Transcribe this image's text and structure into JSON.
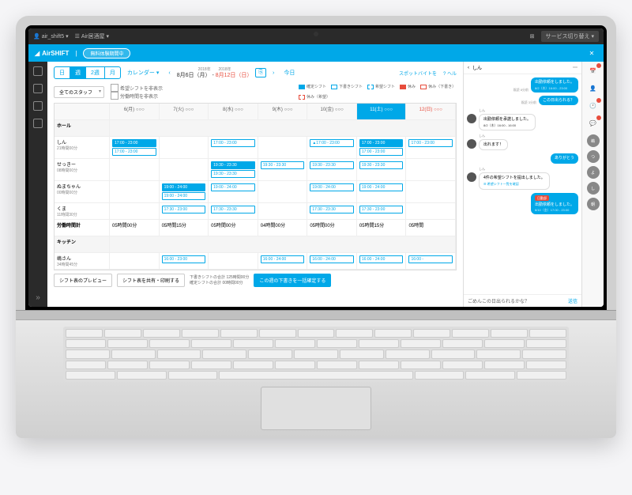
{
  "titlebar": {
    "user": "air_shift5",
    "store": "Air居酒屋",
    "service": "サービス切り替え"
  },
  "appbar": {
    "logo": "AirSHIFT",
    "pill": "無料体験期間中"
  },
  "toprow": {
    "views": {
      "day": "日",
      "week": "週",
      "twoweek": "2週",
      "month": "月",
      "active": "週"
    },
    "calendar": "カレンダー",
    "year": "2018年",
    "range_start": "8月6日（月）",
    "range_end": "8月12日（日）",
    "today": "今日",
    "spot": "スポットバイトを",
    "help": "ヘル"
  },
  "filter": {
    "staff": "全てのスタッフ",
    "hide_request": "希望シフトを非表示",
    "hide_hours": "労働時間を非表示"
  },
  "legend": {
    "confirmed": "確定シフト",
    "draft": "下書きシフト",
    "request": "希望シフト",
    "off": "休み",
    "off_draft": "休み（下書き）",
    "off_request": "休み（希望）"
  },
  "days": [
    {
      "label": "6(月)",
      "cls": ""
    },
    {
      "label": "7(火)",
      "cls": ""
    },
    {
      "label": "8(水)",
      "cls": ""
    },
    {
      "label": "9(木)",
      "cls": ""
    },
    {
      "label": "10(金)",
      "cls": ""
    },
    {
      "label": "11(土)",
      "cls": "sat active"
    },
    {
      "label": "12(日)",
      "cls": "sun"
    }
  ],
  "sections": [
    {
      "name": "ホール",
      "rows": [
        {
          "name": "しん",
          "hours": "21時間00分",
          "shifts": [
            [
              "17:00 - 23:00",
              "17:00 - 23:00"
            ],
            [],
            [
              "17:00 - 23:00"
            ],
            [],
            [
              "▲17:00 - 23:00"
            ],
            [
              "17:00 - 23:00",
              "17:00 - 23:00"
            ],
            [
              "17:00 - 23:00"
            ]
          ]
        },
        {
          "name": "せっきー",
          "hours": "08時間00分",
          "shifts": [
            [],
            [],
            [
              "19:30 - 23:30",
              "19:30 - 23:30"
            ],
            [
              "19:30 - 23:30"
            ],
            [
              "19:30 - 23:30"
            ],
            [
              "19:30 - 23:30"
            ],
            []
          ]
        },
        {
          "name": "ぬまちゃん",
          "hours": "00時間00分",
          "shifts": [
            [],
            [
              "19:00 - 24:00",
              "19:00 - 24:00"
            ],
            [
              "19:00 - 24:00"
            ],
            [],
            [
              "19:00 - 24:00"
            ],
            [
              "19:00 - 24:00"
            ],
            []
          ]
        },
        {
          "name": "くま",
          "hours": "11時間30分",
          "shifts": [
            [],
            [
              "17:30 - 23:00"
            ],
            [
              "17:30 - 23:30"
            ],
            [],
            [
              "17:30 - 23:30"
            ],
            [
              "17:30 - 23:00"
            ],
            []
          ]
        }
      ]
    },
    {
      "name": "労働時間計",
      "sum": true,
      "row": {
        "shifts": [
          "05時間00分",
          "05時間15分",
          "05時間00分",
          "04時間00分",
          "05時間00分",
          "05時間15分",
          "05時間"
        ]
      }
    },
    {
      "name": "キッチン",
      "rows": [
        {
          "name": "嶋さん",
          "hours": "34時間45分",
          "shifts": [
            [],
            [
              "16:00 - 23:00"
            ],
            [],
            [
              "16:00 - 24:00"
            ],
            [
              "16:00 - 24:00"
            ],
            [
              "16:00 - 24:00"
            ],
            [
              "16:00 -"
            ]
          ]
        }
      ]
    }
  ],
  "bottom": {
    "preview": "シフト表のプレビュー",
    "share": "シフト表を共有・印刷する",
    "draft_total_label": "下書きシフトの合計",
    "draft_total": "125時間00分",
    "confirmed_total_label": "確定シフトの合計",
    "confirmed_total": "00時間00分",
    "confirm_all": "この週の下書きを一括確定する"
  },
  "chat": {
    "name": "しん",
    "messages": [
      {
        "side": "right",
        "type": "blue",
        "text": "出勤依頼をしました。",
        "meta": "8/2（木）16:00 - 23:00",
        "time": "既読 8分前"
      },
      {
        "side": "right",
        "type": "blue",
        "text": "この日出られる？",
        "time": "既読 3分前"
      },
      {
        "side": "left",
        "type": "white",
        "speaker": "しん",
        "text": "出勤依頼を承諾しました。",
        "meta": "8/2（木）16:00 - 16:00"
      },
      {
        "side": "left",
        "type": "white",
        "speaker": "しん",
        "text": "出れます！"
      },
      {
        "side": "right",
        "type": "blue",
        "text": "ありがとう"
      },
      {
        "side": "left",
        "type": "white",
        "speaker": "しん",
        "text": "4件の希望シフトを提出しました。",
        "link": "希望シフト一覧を確認"
      },
      {
        "side": "right",
        "type": "blue",
        "text": "出勤依頼をしました。",
        "meta": "8/10（金）17:00 - 23:00",
        "badge": "日勤部"
      }
    ],
    "input": "ごめんこの日出られるかな？",
    "send": "送信"
  },
  "rail": {
    "avatars": [
      "嶋",
      "つ",
      "よ",
      "し",
      "朝"
    ]
  }
}
